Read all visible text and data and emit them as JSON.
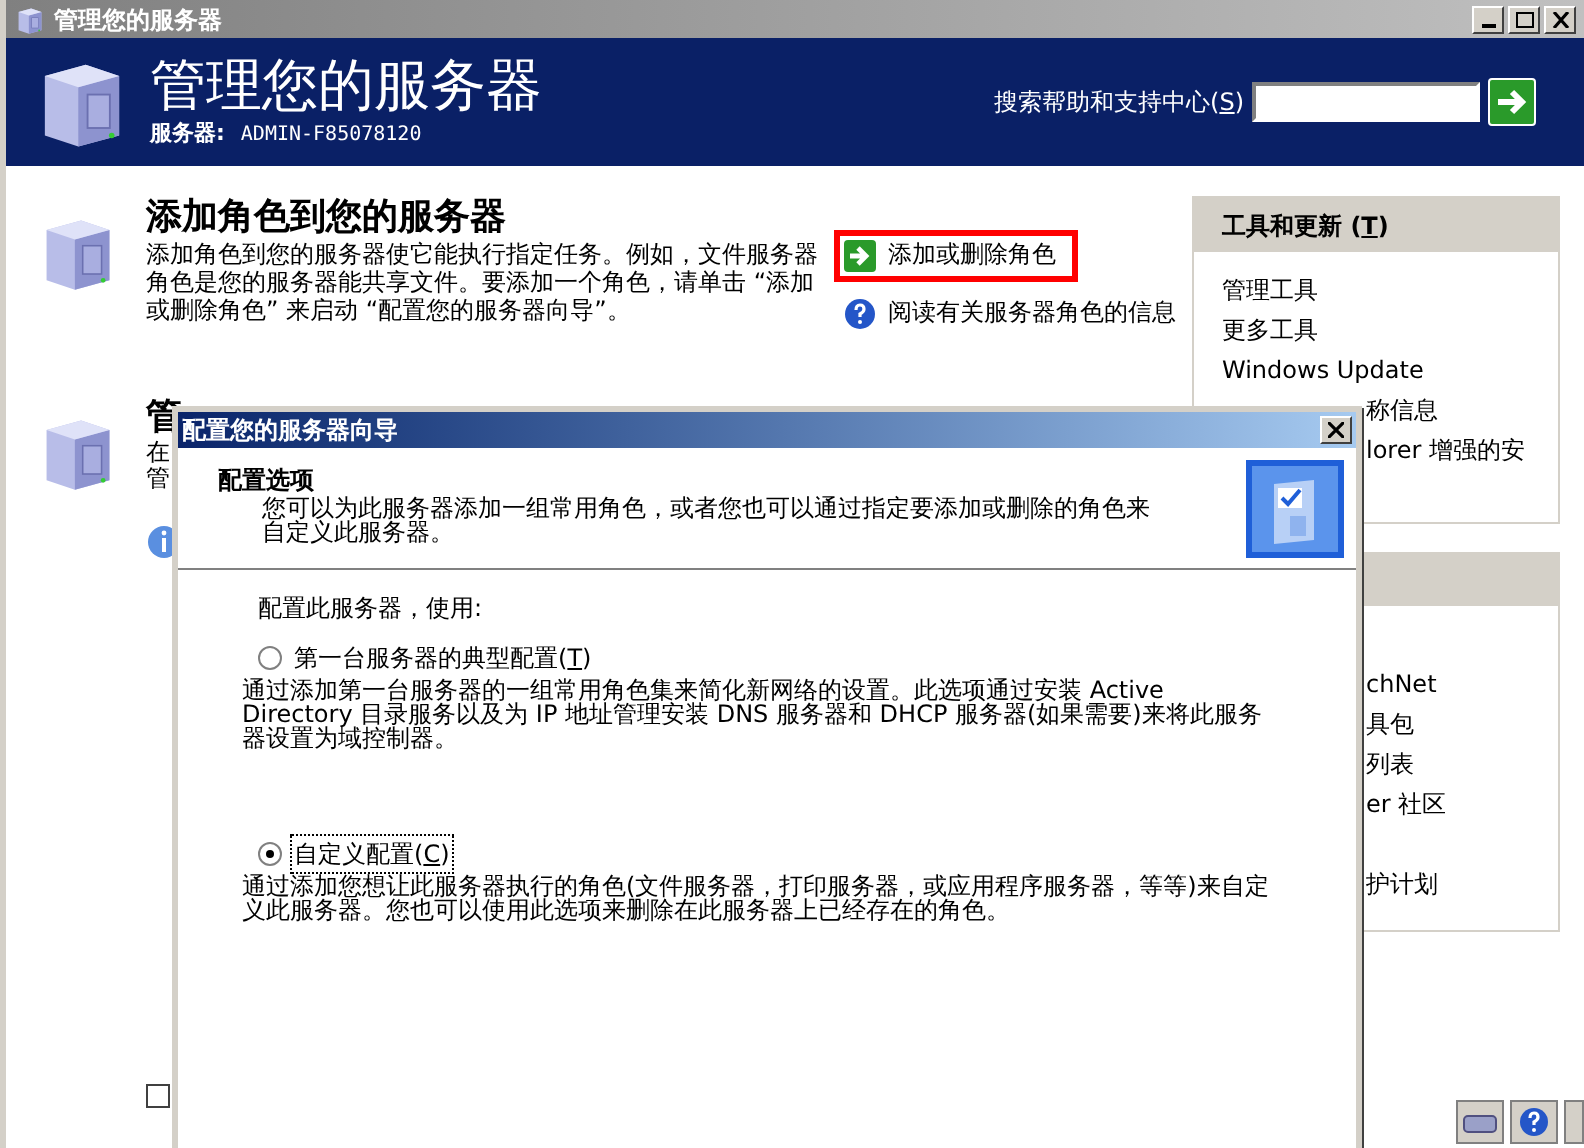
{
  "window": {
    "title": "管理您的服务器"
  },
  "header": {
    "title": "管理您的服务器",
    "server_label": "服务器:",
    "server_name": "ADMIN-F85078120",
    "search_label": "搜索帮助和支持中心",
    "search_shortcut": "(S)"
  },
  "sections": [
    {
      "kind": "full",
      "title": "添加角色到您的服务器",
      "text": "添加角色到您的服务器使它能执行指定任务。例如，文件服务器角色是您的服务器能共享文件。要添加一个角色，请单击 “添加或删除角色” 来启动 “配置您的服务器向导”。"
    },
    {
      "kind": "partial",
      "title": "管",
      "lines": [
        "在",
        "管"
      ]
    }
  ],
  "actions": [
    {
      "kind": "arrow",
      "label": "添加或删除角色",
      "highlighted": true
    },
    {
      "kind": "help",
      "label": "阅读有关服务器角色的信息",
      "highlighted": false
    }
  ],
  "tools_panel": {
    "title": "工具和更新",
    "shortcut": "(T)",
    "items": [
      {
        "label": "管理工具",
        "partial": false
      },
      {
        "label": "更多工具",
        "partial": false
      },
      {
        "label": "Windows Update",
        "partial": false
      },
      {
        "label": "称信息",
        "partial": true
      },
      {
        "label": "lorer 增强的安",
        "partial": true
      }
    ]
  },
  "second_panel": {
    "items": [
      "chNet",
      "具包",
      "列表",
      "er 社区",
      "护计划"
    ]
  },
  "footer_checkbox": {
    "checked": false
  },
  "dialog": {
    "title": "配置您的服务器向导",
    "heading": "配置选项",
    "description": "您可以为此服务器添加一组常用角色，或者您也可以通过指定要添加或删除的角色来自定义此服务器。",
    "prompt": "配置此服务器，使用:",
    "options": [
      {
        "label": "第一台服务器的典型配置",
        "shortcut": "(T)",
        "selected": false,
        "description": "通过添加第一台服务器的一组常用角色集来简化新网络的设置。此选项通过安装 Active Directory 目录服务以及为 IP 地址管理安装 DNS 服务器和 DHCP 服务器(如果需要)来将此服务器设置为域控制器。"
      },
      {
        "label": "自定义配置",
        "shortcut": "(C)",
        "selected": true,
        "description": "通过添加您想让此服务器执行的角色(文件服务器，打印服务器，或应用程序服务器，等等)来自定义此服务器。您也可以使用此选项来删除在此服务器上已经存在的角色。"
      }
    ]
  }
}
